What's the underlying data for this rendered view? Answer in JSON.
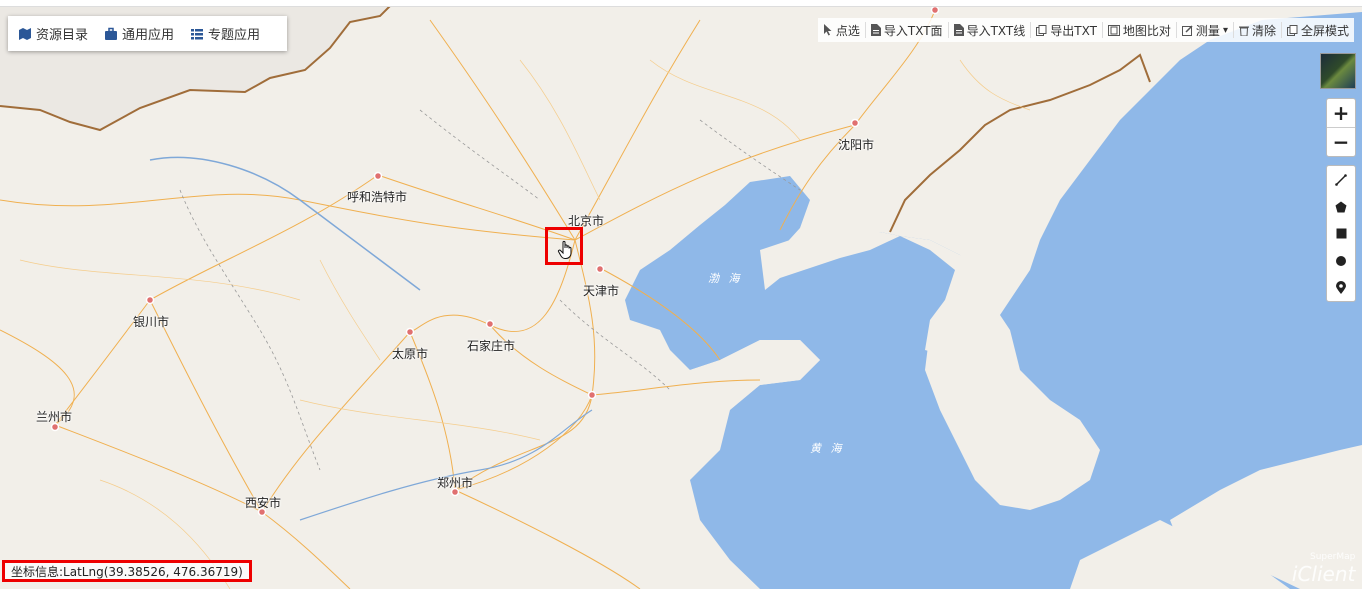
{
  "menu": [
    {
      "label": "资源目录",
      "icon": "map-icon"
    },
    {
      "label": "通用应用",
      "icon": "briefcase-icon"
    },
    {
      "label": "专题应用",
      "icon": "list-icon"
    }
  ],
  "toolbar": [
    {
      "label": "点选",
      "icon": "pointer-icon"
    },
    {
      "label": "导入TXT面",
      "icon": "file-icon"
    },
    {
      "label": "导入TXT线",
      "icon": "file-icon"
    },
    {
      "label": "导出TXT",
      "icon": "copy-icon"
    },
    {
      "label": "地图比对",
      "icon": "film-icon"
    },
    {
      "label": "测量",
      "icon": "edit-icon",
      "dropdown": "▾"
    },
    {
      "label": "清除",
      "icon": "trash-icon"
    },
    {
      "label": "全屏模式",
      "icon": "copy-icon"
    }
  ],
  "zoom": {
    "in": "+",
    "out": "−"
  },
  "draw_tools": [
    "line-draw-icon",
    "polygon-draw-icon",
    "rectangle-draw-icon",
    "circle-draw-icon",
    "marker-draw-icon"
  ],
  "cities": {
    "hohhot": "呼和浩特市",
    "beijing": "北京市",
    "tianjin": "天津市",
    "shenyang": "沈阳市",
    "yinchuan": "银川市",
    "taiyuan": "太原市",
    "shijiazhuang": "石家庄市",
    "lanzhou": "兰州市",
    "xian": "西安市",
    "zhengzhou": "郑州市"
  },
  "seas": {
    "bohai": "渤 海",
    "huanghai": "黄 海"
  },
  "coord_info": "坐标信息:LatLng(39.38526, 476.36719)",
  "logo": {
    "line1": "SuperMap",
    "line2": "iClient"
  },
  "colors": {
    "sea": "#8fb8e8",
    "land": "#f2efe9",
    "road": "#f0b050",
    "highlight": "#e00000"
  }
}
